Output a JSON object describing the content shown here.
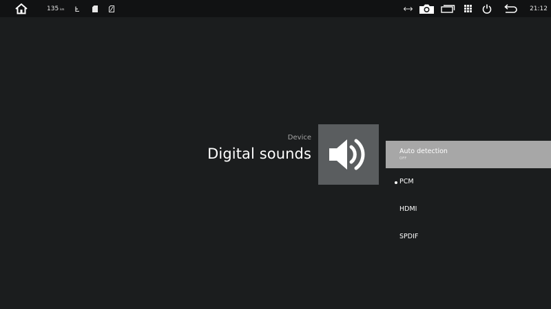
{
  "status_bar": {
    "distance_value": "135",
    "distance_unit": "km",
    "clock": "21:12",
    "icons": [
      "home-icon",
      "usb-icon",
      "sd-card-icon",
      "sd-card-outline-icon",
      "swap-arrows-icon",
      "camera-icon",
      "windows-icon",
      "app-grid-icon",
      "power-icon",
      "back-icon"
    ]
  },
  "header": {
    "category": "Device",
    "title": "Digital sounds"
  },
  "tile": {
    "icon": "speaker-icon",
    "color": "#5a5d5f"
  },
  "options": [
    {
      "label": "Auto detection",
      "sublabel": "OFF"
    },
    {
      "label": "PCM"
    },
    {
      "label": "HDMI"
    },
    {
      "label": "SPDIF"
    }
  ],
  "colors": {
    "background": "#1b1d1e",
    "status_bar": "#111213",
    "selected_row": "#a7a7a7"
  }
}
